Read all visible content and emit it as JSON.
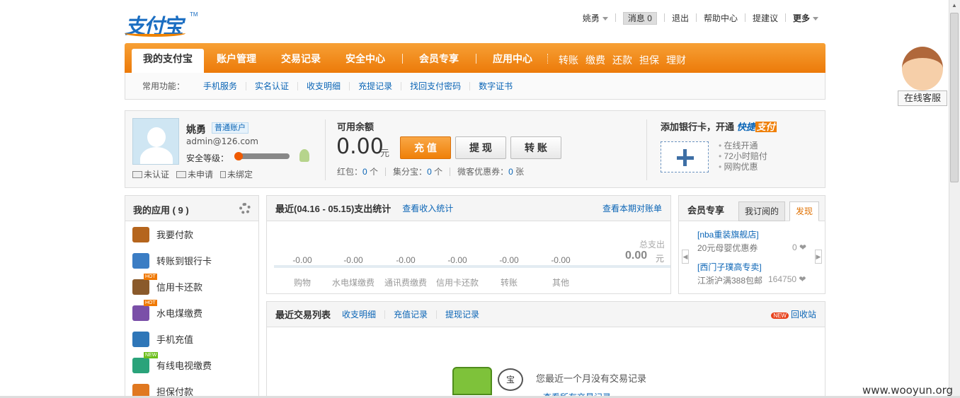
{
  "header": {
    "logo_text": "支付宝",
    "logo_tm": "TM",
    "user": "姚勇",
    "messages_label": "消息",
    "messages_count": "0",
    "logout": "退出",
    "help": "帮助中心",
    "suggest": "提建议",
    "more": "更多"
  },
  "mainnav": {
    "tabs": [
      "我的支付宝",
      "账户管理",
      "交易记录",
      "安全中心",
      "会员专享",
      "应用中心"
    ],
    "quick": [
      "转账",
      "缴费",
      "还款",
      "担保",
      "理财"
    ]
  },
  "subnav": {
    "label": "常用功能：",
    "links": [
      "手机服务",
      "实名认证",
      "收支明细",
      "充提记录",
      "找回支付密码",
      "数字证书"
    ]
  },
  "account": {
    "name": "姚勇",
    "badge": "普通账户",
    "email": "admin@126.com",
    "security_label": "安全等级：",
    "status": [
      "未认证",
      "未申请",
      "未绑定"
    ],
    "balance_label": "可用余额",
    "balance": "0.00",
    "balance_unit": "元",
    "buttons": [
      "充 值",
      "提 现",
      "转 账"
    ],
    "coupons": [
      {
        "label": "红包：",
        "value": "0",
        "unit": " 个"
      },
      {
        "label": "集分宝：",
        "value": "0",
        "unit": " 个"
      },
      {
        "label": "微客优惠券：",
        "value": "0",
        "unit": " 张"
      }
    ],
    "addcard_label": "添加银行卡，开通 ",
    "kuaijie_a": "快捷",
    "kuaijie_b": "支付",
    "perks": [
      "在线开通",
      "72小时赔付",
      "网购优惠"
    ]
  },
  "apps": {
    "title": "我的应用 ( 9 )",
    "items": [
      {
        "label": "我要付款",
        "color": "#b5651d",
        "badge": ""
      },
      {
        "label": "转账到银行卡",
        "color": "#3b7dc4",
        "badge": ""
      },
      {
        "label": "信用卡还款",
        "color": "#8a5a2b",
        "badge": "HOT"
      },
      {
        "label": "水电煤缴费",
        "color": "#7a4fa8",
        "badge": "HOT"
      },
      {
        "label": "手机充值",
        "color": "#2e76b8",
        "badge": ""
      },
      {
        "label": "有线电视缴费",
        "color": "#2aa37a",
        "badge": "NEW"
      },
      {
        "label": "担保付款",
        "color": "#e07820",
        "badge": ""
      }
    ]
  },
  "stats": {
    "title": "最近(04.16 - 05.15)支出统计",
    "link": "查看收入统计",
    "right_link": "查看本期对账单",
    "categories": [
      {
        "label": "购物",
        "value": "-0.00"
      },
      {
        "label": "水电煤缴费",
        "value": "-0.00"
      },
      {
        "label": "通讯费缴费",
        "value": "-0.00"
      },
      {
        "label": "信用卡还款",
        "value": "-0.00"
      },
      {
        "label": "转账",
        "value": "-0.00"
      },
      {
        "label": "其他",
        "value": "-0.00"
      }
    ],
    "total_label": "总支出",
    "total": "0.00",
    "total_unit": "元"
  },
  "member": {
    "title": "会员专享",
    "tabs": [
      "我订阅的",
      "发现"
    ],
    "items": [
      {
        "title": "[nba重装旗舰店]",
        "sub": "20元母婴优惠券",
        "count": "0"
      },
      {
        "title": "[西门子璞高专卖]",
        "sub": "江浙沪满388包邮",
        "count": "164750"
      }
    ]
  },
  "transactions": {
    "title": "最近交易列表",
    "links": [
      "收支明细",
      "充值记录",
      "提现记录"
    ],
    "new_badge": "NEW",
    "recycle": "回收站",
    "empty_text": "您最近一个月没有交易记录",
    "empty_link": "查看所有交易记录",
    "bubble": "宝"
  },
  "side": {
    "online_service": "在线客服"
  },
  "watermark": "www.wooyun.org"
}
